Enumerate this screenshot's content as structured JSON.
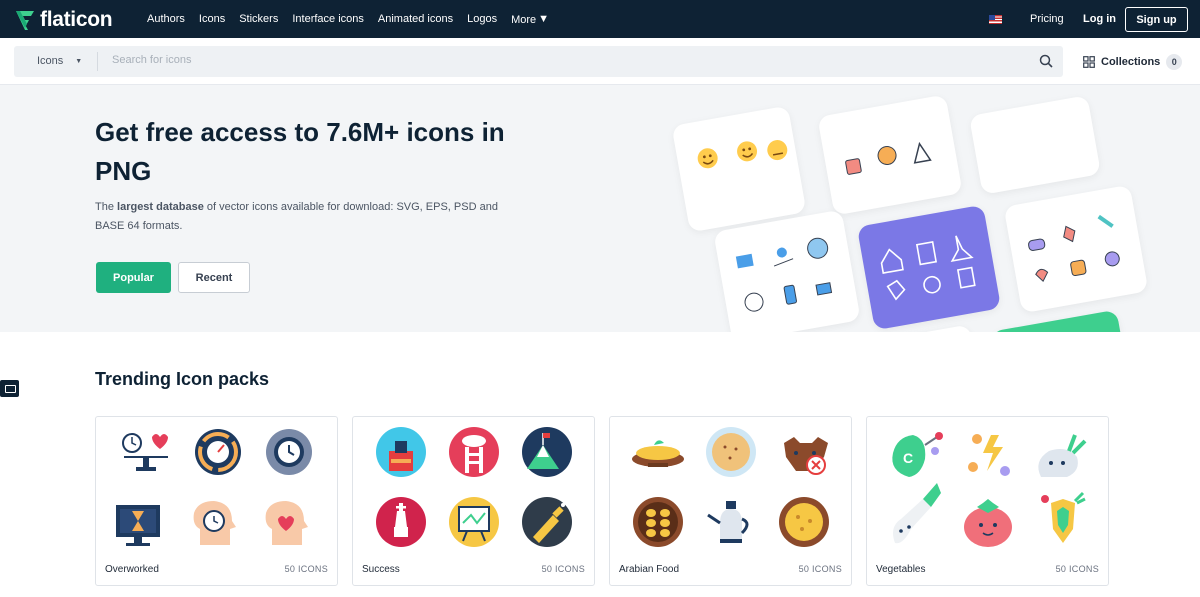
{
  "nav": {
    "logo": "flaticon",
    "links": [
      "Authors",
      "Icons",
      "Stickers",
      "Interface icons",
      "Animated icons",
      "Logos",
      "More"
    ],
    "pricing": "Pricing",
    "login": "Log in",
    "signup": "Sign up"
  },
  "search": {
    "type_label": "Icons",
    "placeholder": "Search for icons",
    "collections_label": "Collections",
    "collections_count": "0"
  },
  "hero": {
    "title": "Get free access to 7.6M+ icons in PNG",
    "desc_pre": "The ",
    "desc_bold": "largest database",
    "desc_post": " of vector icons available for download: SVG, EPS, PSD and BASE 64 formats.",
    "btn_popular": "Popular",
    "btn_recent": "Recent"
  },
  "trending": {
    "title": "Trending Icon packs",
    "packs": [
      {
        "name": "Overworked",
        "count": "50 ICONS"
      },
      {
        "name": "Success",
        "count": "50 ICONS"
      },
      {
        "name": "Arabian Food",
        "count": "50 ICONS"
      },
      {
        "name": "Vegetables",
        "count": "50 ICONS"
      }
    ]
  },
  "colors": {
    "nav_bg": "#0e2234",
    "accent": "#1fb07f",
    "purple_tile": "#7b78e6",
    "green_tile": "#3ecf8e"
  }
}
